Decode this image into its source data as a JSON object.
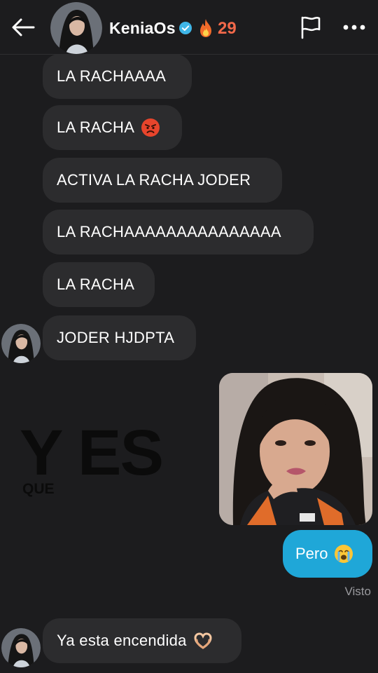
{
  "header": {
    "username": "KeniaOs",
    "verified": true,
    "streak_count": "29",
    "back_icon": "arrow-left-icon",
    "flag_icon": "flag-icon",
    "more_icon": "more-dots-icon"
  },
  "messages": [
    {
      "text": "LA RACHAAAA",
      "emoji": null
    },
    {
      "text": "LA RACHA",
      "emoji": "angry-face-emoji"
    },
    {
      "text": "ACTIVA LA RACHA JODER",
      "emoji": null
    },
    {
      "text": "LA RACHAAAAAAAAAAAAAAA",
      "emoji": null
    },
    {
      "text": "LA RACHA",
      "emoji": null
    },
    {
      "text": "JODER HJDPTA",
      "emoji": null
    }
  ],
  "overlay": {
    "big_text": "Y ES",
    "small_text": "QUE"
  },
  "sent": {
    "image": "selfie-photo",
    "text": "Pero",
    "emoji": "crying-face-emoji",
    "status": "Visto"
  },
  "last_message": {
    "text": "Ya esta encendida",
    "emoji": "heart-hands-emoji"
  },
  "colors": {
    "background": "#1c1c1e",
    "bubble_received": "#2c2c2e",
    "bubble_sent": "#1fa7d8",
    "streak": "#f2694a",
    "verified": "#3fb6e8"
  }
}
